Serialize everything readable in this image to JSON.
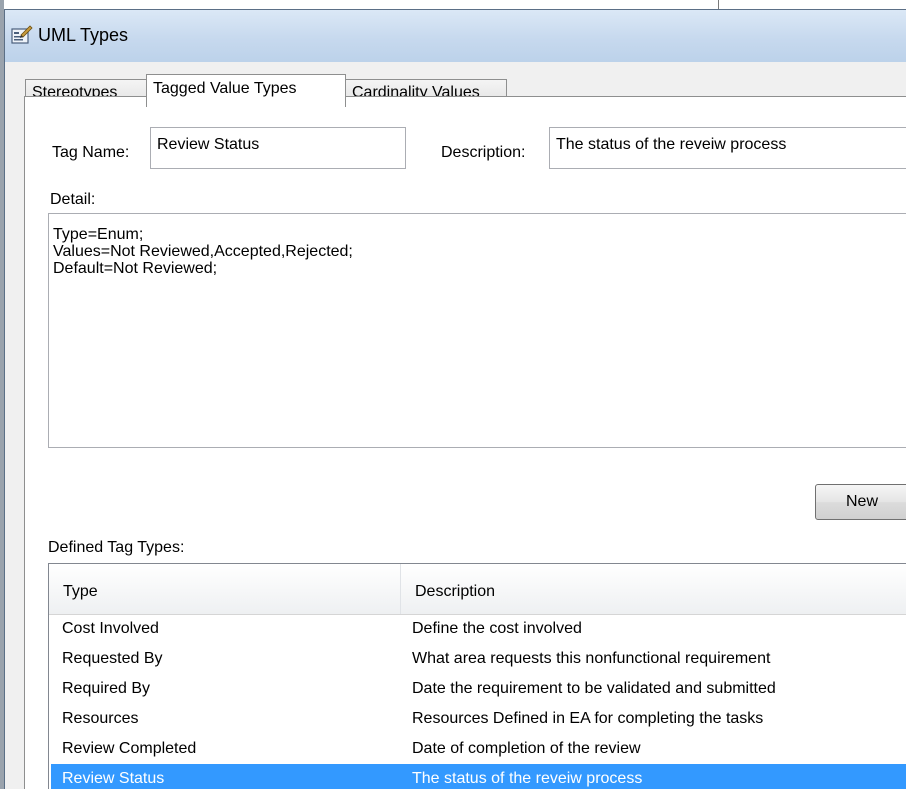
{
  "window": {
    "title": "UML Types"
  },
  "tabs": [
    {
      "label": "Stereotypes",
      "active": false
    },
    {
      "label": "Tagged Value Types",
      "active": true
    },
    {
      "label": "Cardinality Values",
      "active": false
    }
  ],
  "form": {
    "tag_name_label": "Tag Name:",
    "tag_name_value": "Review Status",
    "description_label": "Description:",
    "description_value": "The status of the reveiw process",
    "detail_label": "Detail:",
    "detail_value": "Type=Enum;\nValues=Not Reviewed,Accepted,Rejected;\nDefault=Not Reviewed;",
    "new_button": "New"
  },
  "defined_tag_types": {
    "label": "Defined Tag Types:",
    "columns": [
      "Type",
      "Description"
    ],
    "rows": [
      {
        "type": "Cost Involved",
        "description": "Define the cost involved",
        "selected": false
      },
      {
        "type": "Requested By",
        "description": "What area requests this nonfunctional requirement",
        "selected": false
      },
      {
        "type": "Required By",
        "description": "Date the requirement to be validated and submitted",
        "selected": false
      },
      {
        "type": "Resources",
        "description": "Resources Defined in EA for completing the tasks",
        "selected": false
      },
      {
        "type": "Review Completed",
        "description": "Date of completion of the review",
        "selected": false
      },
      {
        "type": "Review Status",
        "description": "The status of the reveiw process",
        "selected": true
      }
    ]
  },
  "colors": {
    "selection": "#3399ff",
    "titlebar": "#c7d9ee",
    "dialog_background": "#f0f0f0"
  },
  "icons": {
    "title_icon": "uml-types-window-icon"
  }
}
